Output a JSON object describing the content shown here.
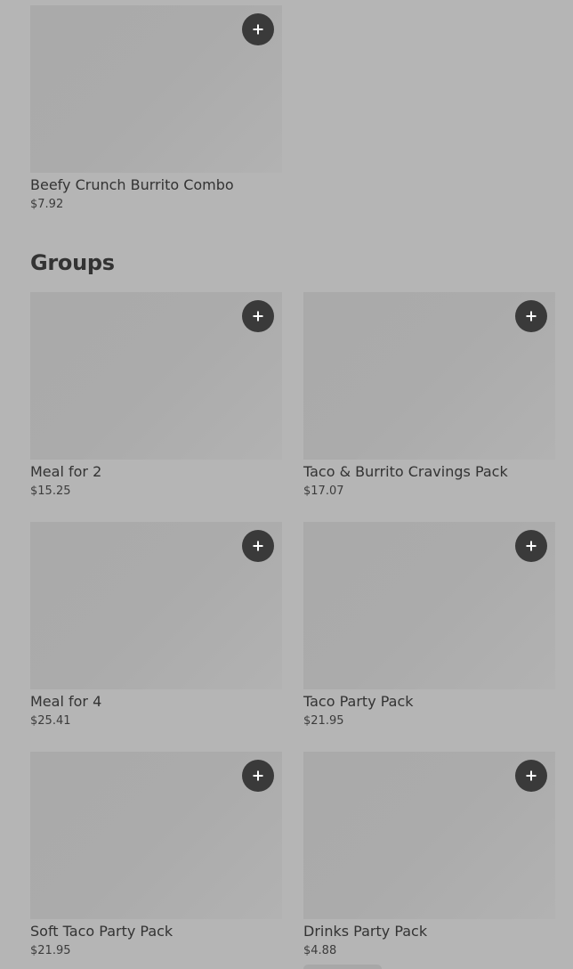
{
  "top_item": {
    "name": "Beefy Crunch Burrito Combo",
    "price": "$7.92"
  },
  "groups": {
    "title": "Groups",
    "items": [
      {
        "name": "Meal for 2",
        "price": "$15.25"
      },
      {
        "name": "Taco & Burrito Cravings Pack",
        "price": "$17.07"
      },
      {
        "name": "Meal for 4",
        "price": "$25.41"
      },
      {
        "name": "Taco Party Pack",
        "price": "$21.95"
      },
      {
        "name": "Soft Taco Party Pack",
        "price": "$21.95"
      },
      {
        "name": "Drinks Party Pack",
        "price": "$4.88"
      }
    ]
  },
  "icons": {
    "add": "plus-icon"
  },
  "colors": {
    "background": "#b5b5b5",
    "thumbnail": "#ababab",
    "add_button": "#3a3a3a",
    "text": "#333333"
  }
}
